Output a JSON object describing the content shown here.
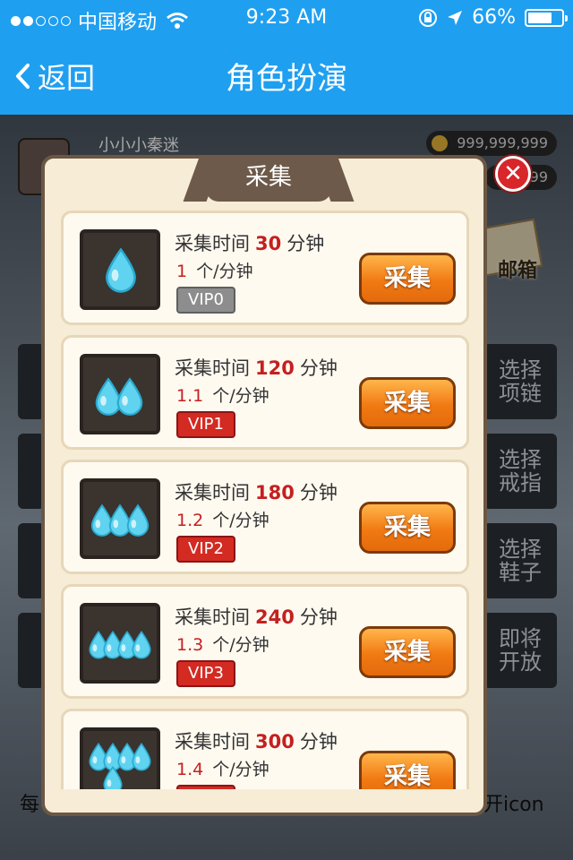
{
  "status_bar": {
    "carrier": "中国移动",
    "time": "9:23 AM",
    "battery": "66%"
  },
  "nav": {
    "back_label": "返回",
    "title": "角色扮演"
  },
  "background": {
    "player_name": "小小小秦迷",
    "coins": "999,999,999",
    "coins2": "99",
    "mail_label": "邮箱",
    "side_buttons": [
      "选择\n项链",
      "选择\n戒指",
      "选择\n鞋子",
      "即将\n开放"
    ],
    "bottom_left": "每",
    "bottom_right": "开icon"
  },
  "modal": {
    "tab_title": "采集",
    "items": [
      {
        "time_label": "采集时间",
        "time": "30",
        "time_unit": "分钟",
        "rate": "1",
        "rate_unit": "个/分钟",
        "vip": "VIP0",
        "drops": 1,
        "button": "采集"
      },
      {
        "time_label": "采集时间",
        "time": "120",
        "time_unit": "分钟",
        "rate": "1.1",
        "rate_unit": "个/分钟",
        "vip": "VIP1",
        "drops": 2,
        "button": "采集"
      },
      {
        "time_label": "采集时间",
        "time": "180",
        "time_unit": "分钟",
        "rate": "1.2",
        "rate_unit": "个/分钟",
        "vip": "VIP2",
        "drops": 3,
        "button": "采集"
      },
      {
        "time_label": "采集时间",
        "time": "240",
        "time_unit": "分钟",
        "rate": "1.3",
        "rate_unit": "个/分钟",
        "vip": "VIP3",
        "drops": 4,
        "button": "采集"
      },
      {
        "time_label": "采集时间",
        "time": "300",
        "time_unit": "分钟",
        "rate": "1.4",
        "rate_unit": "个/分钟",
        "vip": "",
        "drops": 5,
        "button": "采集"
      }
    ]
  },
  "colors": {
    "nav_bg": "#1f9ff0",
    "value_red": "#c32020",
    "button_orange": "#f17a13",
    "vip_gray": "#8d8d8d",
    "vip_red": "#d32a22"
  }
}
